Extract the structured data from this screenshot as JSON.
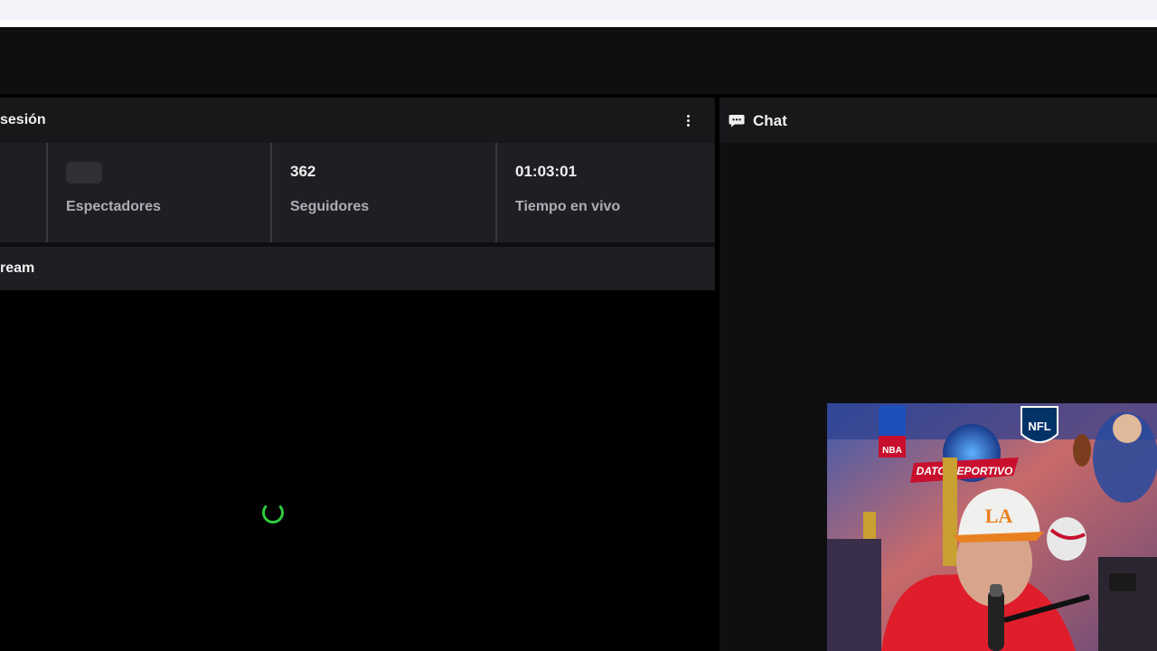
{
  "session": {
    "title": "sesión",
    "stats": [
      {
        "value": "",
        "label": "Espectadores"
      },
      {
        "value": "362",
        "label": "Seguidores"
      },
      {
        "value": "01:03:01",
        "label": "Tiempo en vivo"
      }
    ]
  },
  "stream": {
    "title": "ream"
  },
  "chat": {
    "title": "Chat"
  },
  "webcam": {
    "banner_text": "DATO DEPORTIVO",
    "logo_left": "NBA",
    "logo_right": "NFL",
    "cap_text": "LA"
  },
  "colors": {
    "spinner": "#2ecc40",
    "background": "#0e0e10"
  }
}
